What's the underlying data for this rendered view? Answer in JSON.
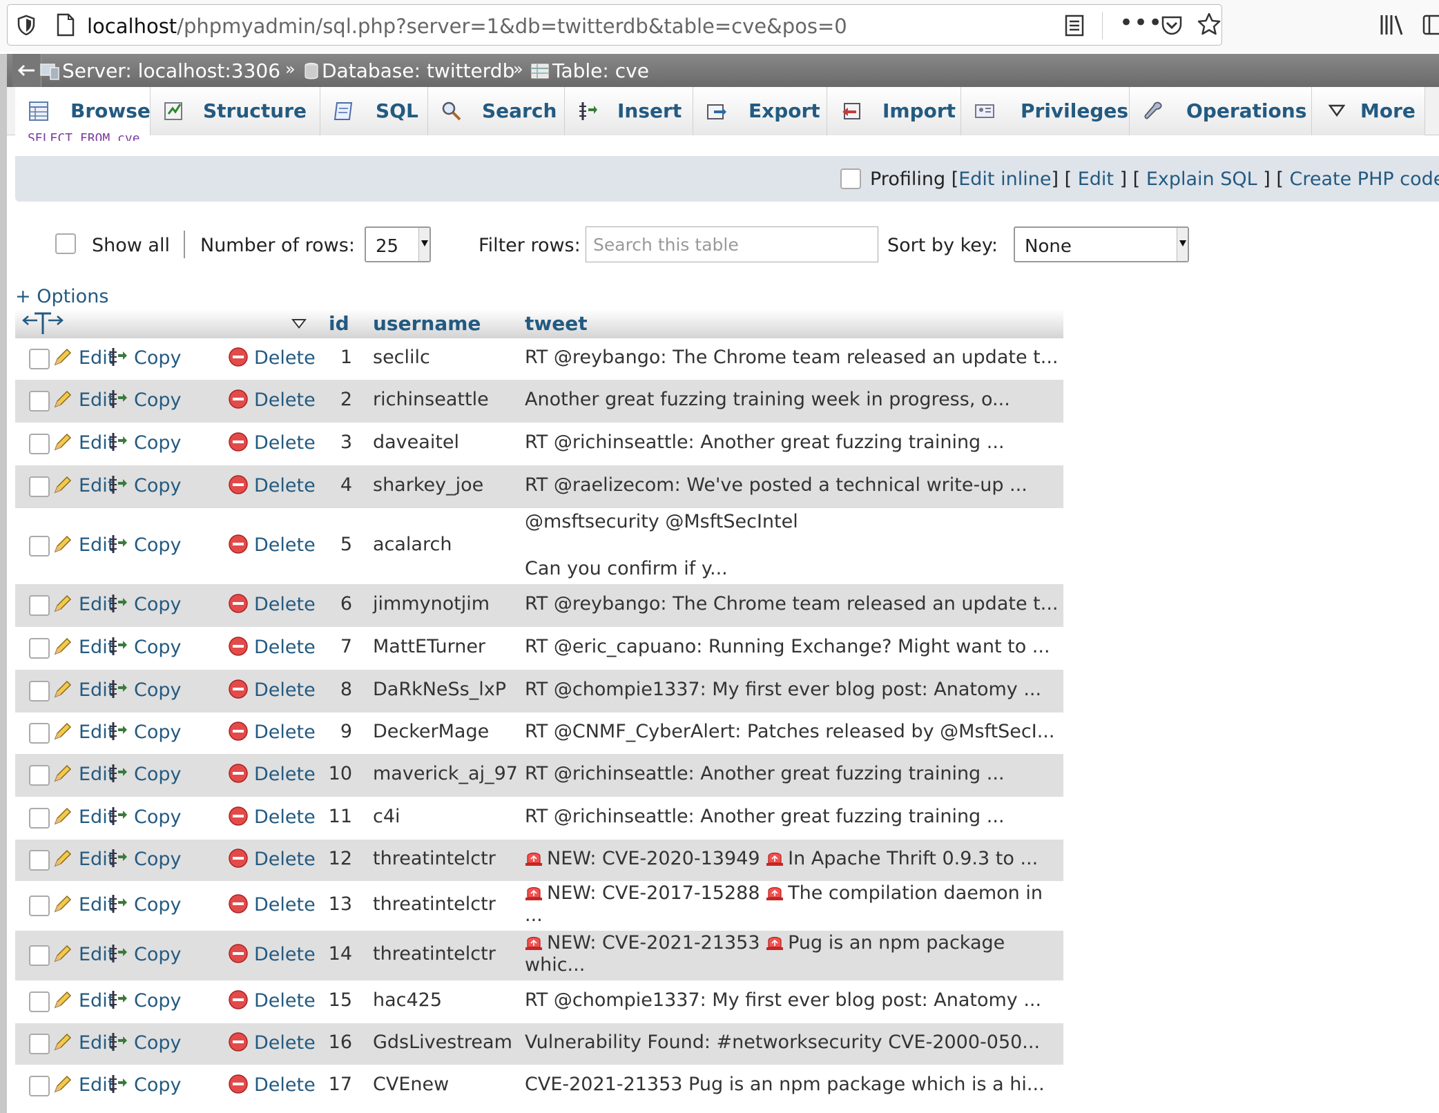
{
  "browser": {
    "url_host": "localhost",
    "url_path": "/phpmyadmin/sql.php?server=1&db=twitterdb&table=cve&pos=0"
  },
  "breadcrumb": {
    "server": "Server: localhost:3306",
    "database": "Database: twitterdb",
    "table": "Table: cve",
    "sep": "»"
  },
  "tabs": [
    {
      "label": "Browse",
      "icon": "browse-icon"
    },
    {
      "label": "Structure",
      "icon": "structure-icon"
    },
    {
      "label": "SQL",
      "icon": "sql-icon"
    },
    {
      "label": "Search",
      "icon": "search-icon"
    },
    {
      "label": "Insert",
      "icon": "insert-icon"
    },
    {
      "label": "Export",
      "icon": "export-icon"
    },
    {
      "label": "Import",
      "icon": "import-icon"
    },
    {
      "label": "Privileges",
      "icon": "privileges-icon"
    },
    {
      "label": "Operations",
      "icon": "operations-icon"
    },
    {
      "label": "More",
      "icon": "more-icon"
    }
  ],
  "query_snippet": "SELECT   FROM   cve",
  "profiling": {
    "label": "Profiling",
    "edit_inline": "Edit inline",
    "edit": "Edit",
    "explain": "Explain SQL",
    "create_php": "Create PHP code"
  },
  "nav": {
    "show_all": "Show all",
    "rows_label": "Number of rows:",
    "rows_value": "25",
    "filter_label": "Filter rows:",
    "filter_placeholder": "Search this table",
    "sort_label": "Sort by key:",
    "sort_value": "None"
  },
  "options_link": "+ Options",
  "columns": {
    "id": "id",
    "username": "username",
    "tweet": "tweet"
  },
  "actions": {
    "edit": "Edit",
    "copy": "Copy",
    "delete": "Delete"
  },
  "rows": [
    {
      "id": "1",
      "username": "seclilc",
      "tweet": [
        "RT @reybango: The Chrome team released an update t..."
      ]
    },
    {
      "id": "2",
      "username": "richinseattle",
      "tweet": [
        "Another great fuzzing training week in progress, o..."
      ]
    },
    {
      "id": "3",
      "username": "daveaitel",
      "tweet": [
        "RT @richinseattle: Another great fuzzing training ..."
      ]
    },
    {
      "id": "4",
      "username": "sharkey_joe",
      "tweet": [
        "RT @raelizecom: We've posted a technical write-up ..."
      ]
    },
    {
      "id": "5",
      "username": "acalarch",
      "tweet": [
        "@msftsecurity @MsftSecIntel",
        "",
        "Can you confirm if y..."
      ]
    },
    {
      "id": "6",
      "username": "jimmynotjim",
      "tweet": [
        "RT @reybango: The Chrome team released an update t..."
      ]
    },
    {
      "id": "7",
      "username": "MattETurner",
      "tweet": [
        "RT @eric_capuano: Running Exchange? Might want to ..."
      ]
    },
    {
      "id": "8",
      "username": "DaRkNeSs_lxP",
      "tweet": [
        "RT @chompie1337: My first ever blog post: Anatomy ..."
      ]
    },
    {
      "id": "9",
      "username": "DeckerMage",
      "tweet": [
        "RT @CNMF_CyberAlert: Patches released by @MsftSecI..."
      ]
    },
    {
      "id": "10",
      "username": "maverick_aj_97",
      "tweet": [
        "RT @richinseattle: Another great fuzzing training ..."
      ]
    },
    {
      "id": "11",
      "username": "c4i",
      "tweet": [
        "RT @richinseattle: Another great fuzzing training ..."
      ]
    },
    {
      "id": "12",
      "username": "threatintelctr",
      "tweet": [
        "NEW: CVE-2020-13949",
        "In Apache Thrift 0.9.3 to ..."
      ],
      "alarm": true
    },
    {
      "id": "13",
      "username": "threatintelctr",
      "tweet": [
        "NEW: CVE-2017-15288",
        "The compilation daemon in",
        "..."
      ],
      "alarm": true
    },
    {
      "id": "14",
      "username": "threatintelctr",
      "tweet": [
        "NEW: CVE-2021-21353",
        "Pug is an npm package",
        "whic..."
      ],
      "alarm": true
    },
    {
      "id": "15",
      "username": "hac425",
      "tweet": [
        "RT @chompie1337: My first ever blog post: Anatomy ..."
      ]
    },
    {
      "id": "16",
      "username": "GdsLivestream",
      "tweet": [
        "Vulnerability Found: #networksecurity CVE-2000-050..."
      ]
    },
    {
      "id": "17",
      "username": "CVEnew",
      "tweet": [
        "CVE-2021-21353 Pug is an npm package which is a hi..."
      ]
    }
  ]
}
